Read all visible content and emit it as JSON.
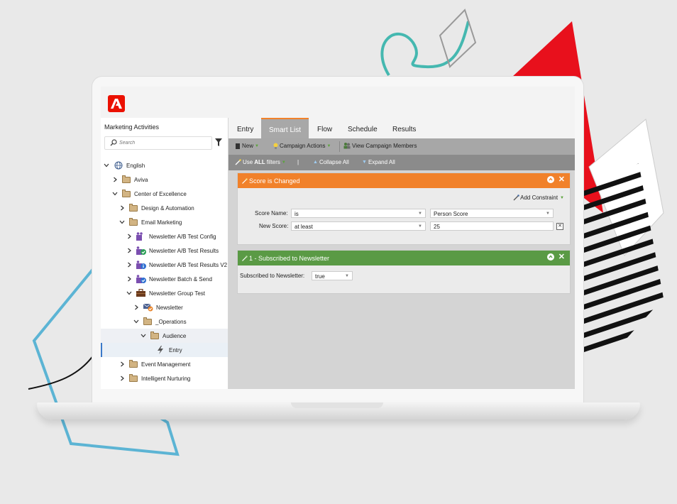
{
  "left_panel": {
    "title": "Marketing Activities",
    "search_placeholder": "Search",
    "tree": [
      {
        "label": "English",
        "icon": "globe-icon",
        "expanded": true
      },
      {
        "label": "Aviva",
        "icon": "folder-icon",
        "expanded": false
      },
      {
        "label": "Center of Excellence",
        "icon": "folder-icon",
        "expanded": true
      },
      {
        "label": "Design & Automation",
        "icon": "folder-icon",
        "expanded": false
      },
      {
        "label": "Email Marketing",
        "icon": "folder-icon",
        "expanded": true
      },
      {
        "label": "Newsletter A/B Test Config",
        "icon": "program-icon",
        "expanded": false
      },
      {
        "label": "Newsletter A/B Test Results",
        "icon": "program-check-icon",
        "expanded": false
      },
      {
        "label": "Newsletter A/B Test Results V2",
        "icon": "program-info-icon",
        "expanded": false
      },
      {
        "label": "Newsletter Batch & Send",
        "icon": "program-check-icon",
        "expanded": false
      },
      {
        "label": "Newsletter Group Test",
        "icon": "briefcase-icon",
        "expanded": true
      },
      {
        "label": "Newsletter",
        "icon": "email-program-icon",
        "expanded": false
      },
      {
        "label": "_Operations",
        "icon": "folder-icon",
        "expanded": true
      },
      {
        "label": "Audience",
        "icon": "folder-icon",
        "expanded": true
      },
      {
        "label": "Entry",
        "icon": "lightning-icon",
        "expanded": false
      },
      {
        "label": "Event Management",
        "icon": "folder-icon",
        "expanded": false
      },
      {
        "label": "Intelligent Nurturing",
        "icon": "folder-icon",
        "expanded": false
      }
    ]
  },
  "tabs": [
    "Entry",
    "Smart List",
    "Flow",
    "Schedule",
    "Results"
  ],
  "active_tab": "Smart List",
  "toolbar": {
    "new_label": "New",
    "campaign_actions_label": "Campaign Actions",
    "view_members_label": "View Campaign Members"
  },
  "filterbar": {
    "use_prefix": "Use",
    "use_all": "ALL",
    "use_suffix": "filters",
    "separator": "|",
    "collapse_label": "Collapse All",
    "expand_label": "Expand All"
  },
  "trigger": {
    "title": "Score is Changed",
    "add_constraint_label": "Add Constraint",
    "score_name_label": "Score Name:",
    "score_name_operator": "is",
    "score_name_value": "Person Score",
    "new_score_label": "New Score:",
    "new_score_operator": "at least",
    "new_score_value": "25"
  },
  "filter": {
    "title": "1 - Subscribed to Newsletter",
    "field_label": "Subscribed to Newsletter:",
    "field_value": "true"
  },
  "colors": {
    "trigger_header": "#f1812a",
    "filter_header": "#5a9a45",
    "adobe_red": "#eb1000",
    "tab_accent": "#f1812a"
  }
}
